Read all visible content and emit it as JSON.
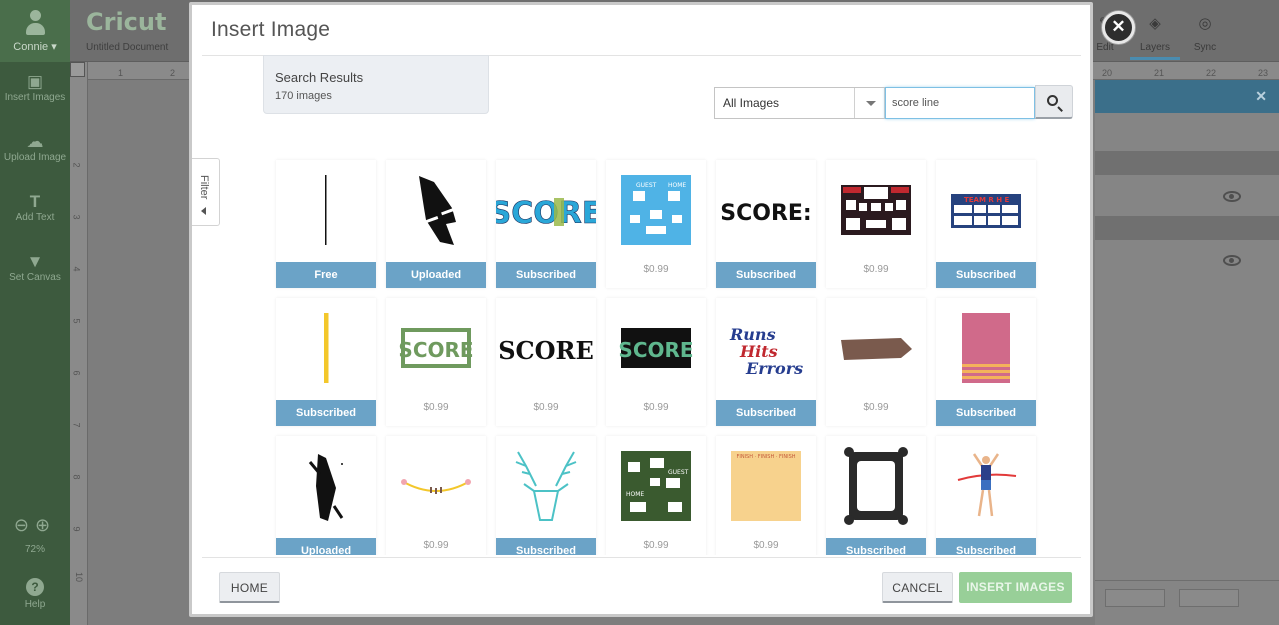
{
  "app": {
    "logo_text": "Cricut",
    "document_title": "Untitled Document",
    "user_name": "Connie",
    "zoom": "72%",
    "sidebar": [
      {
        "label": "Insert Images",
        "icon": "image-icon"
      },
      {
        "label": "Upload Image",
        "icon": "cloud-upload-icon"
      },
      {
        "label": "Add Text",
        "icon": "text-icon"
      },
      {
        "label": "Set Canvas",
        "icon": "shirt-icon"
      }
    ],
    "help_label": "Help",
    "toolbar": {
      "edit_label": "Edit",
      "layers_label": "Layers",
      "sync_label": "Sync"
    },
    "ruler_top": [
      "1",
      "2",
      "20",
      "21",
      "22",
      "23"
    ],
    "ruler_left": [
      "2",
      "3",
      "4",
      "5",
      "6",
      "7",
      "8",
      "9",
      "10"
    ]
  },
  "modal": {
    "title": "Insert Image",
    "results": {
      "title": "Search Results",
      "count": "170 images"
    },
    "filter_label": "Filter",
    "category_select": {
      "value": "All Images"
    },
    "search": {
      "value": "score line"
    },
    "images": [
      {
        "badge": "Free",
        "price": ""
      },
      {
        "badge": "Uploaded",
        "price": ""
      },
      {
        "badge": "Subscribed",
        "price": ""
      },
      {
        "badge": "",
        "price": "$0.99"
      },
      {
        "badge": "Subscribed",
        "price": ""
      },
      {
        "badge": "",
        "price": "$0.99"
      },
      {
        "badge": "Subscribed",
        "price": ""
      },
      {
        "badge": "Subscribed",
        "price": ""
      },
      {
        "badge": "",
        "price": "$0.99"
      },
      {
        "badge": "",
        "price": "$0.99"
      },
      {
        "badge": "",
        "price": "$0.99"
      },
      {
        "badge": "Subscribed",
        "price": ""
      },
      {
        "badge": "",
        "price": "$0.99"
      },
      {
        "badge": "Subscribed",
        "price": ""
      },
      {
        "badge": "Uploaded",
        "price": ""
      },
      {
        "badge": "",
        "price": "$0.99"
      },
      {
        "badge": "Subscribed",
        "price": ""
      },
      {
        "badge": "",
        "price": "$0.99"
      },
      {
        "badge": "",
        "price": "$0.99"
      },
      {
        "badge": "Subscribed",
        "price": ""
      },
      {
        "badge": "Subscribed",
        "price": ""
      }
    ],
    "thumbnail_text": {
      "score_1": "SCORE",
      "score_2": "SCORE:",
      "score_3": "SCORE",
      "score_4": "SCORE",
      "score_5": "SCORE",
      "board_guest": "GUEST",
      "board_home": "HOME",
      "board_team": "TEAM R H E",
      "board_home2": "HOME",
      "board_visitor": "VISITOR",
      "runs": "Runs",
      "hits": "Hits",
      "errors": "Errors",
      "finish": "FINISH · FINISH · FINISH",
      "chalk_home": "HOME",
      "chalk_guest": "GUEST"
    },
    "buttons": {
      "home": "HOME",
      "cancel": "CANCEL",
      "insert": "INSERT IMAGES"
    }
  }
}
